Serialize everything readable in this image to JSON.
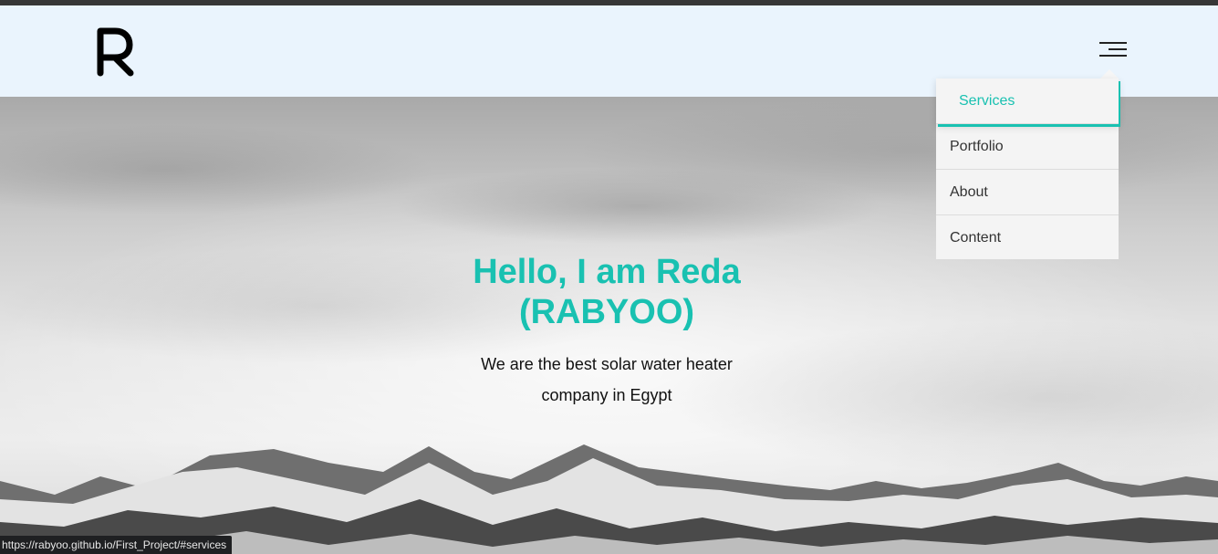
{
  "header": {
    "logo_letter": "R",
    "menu_icon": "hamburger-icon"
  },
  "nav_menu": {
    "items": [
      {
        "label": "Services",
        "active": true
      },
      {
        "label": "Portfolio",
        "active": false
      },
      {
        "label": "About",
        "active": false
      },
      {
        "label": "Content",
        "active": false
      }
    ]
  },
  "hero": {
    "title": "Hello, I am Reda (RABYOO)",
    "subtitle": "We are the best solar water heater company in Egypt",
    "background": "snowy-mountains-under-cloudy-sky"
  },
  "status_bar": {
    "url": "https://rabyoo.github.io/First_Project/#services"
  },
  "colors": {
    "accent": "#19c1b1",
    "header_bg": "#eaf4fd",
    "menu_bg": "#f4f4f4",
    "text": "#111111"
  }
}
